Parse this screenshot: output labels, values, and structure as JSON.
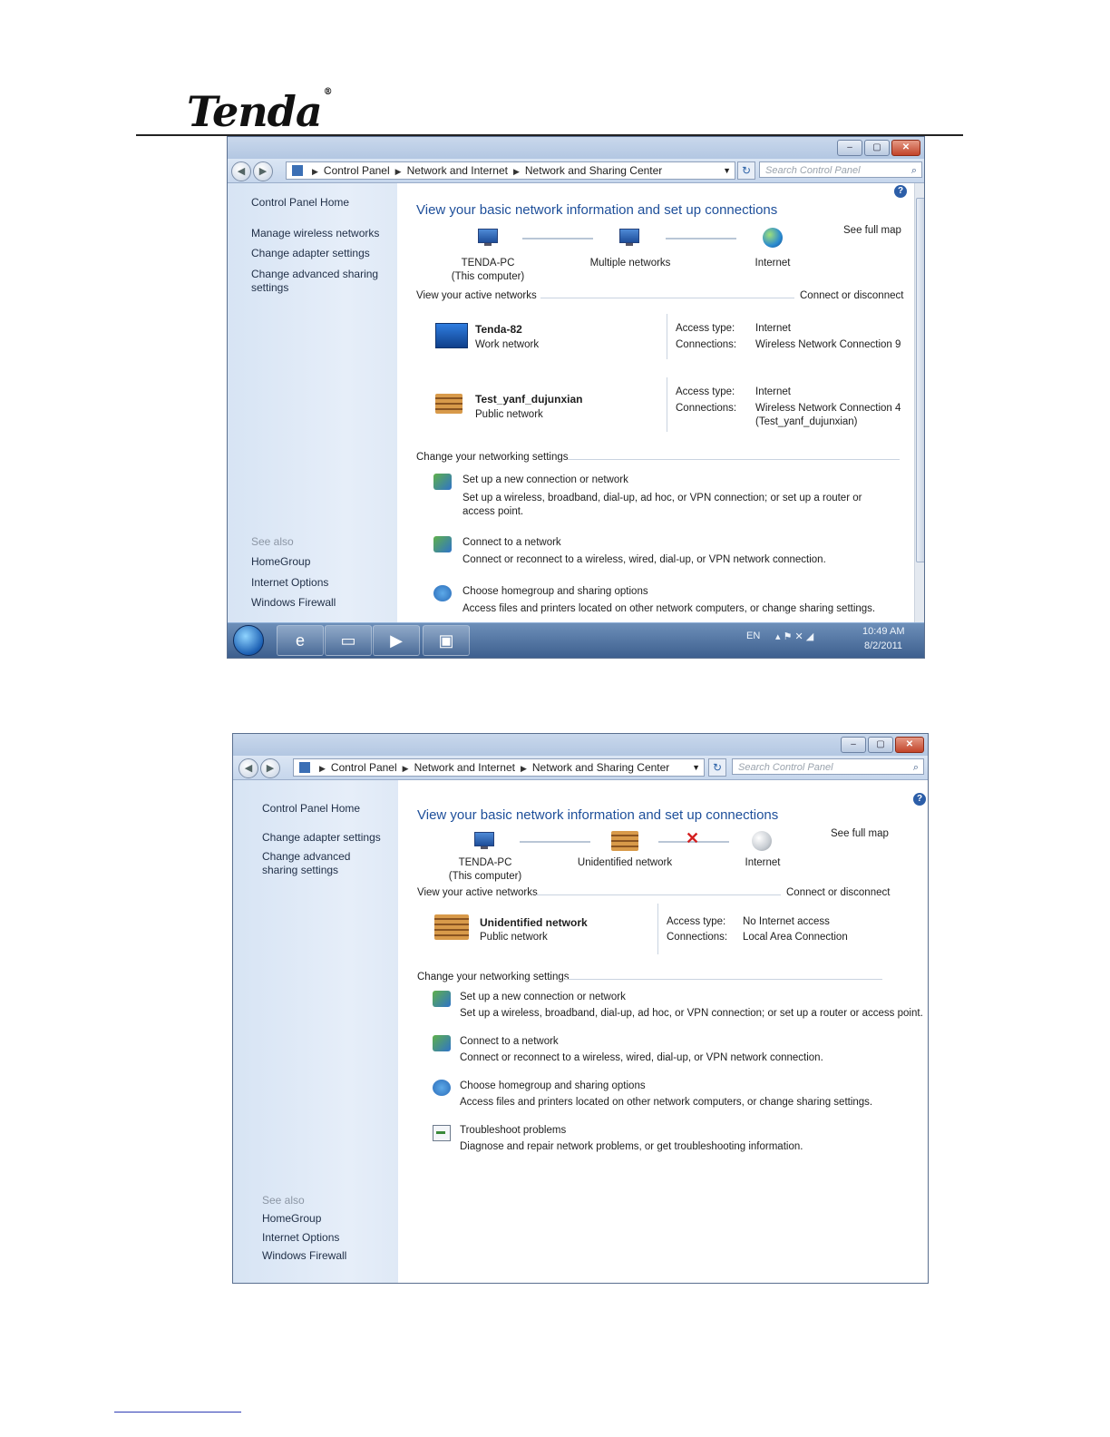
{
  "logo": {
    "text": "Tenda",
    "mark": "®"
  },
  "window1": {
    "title_buttons": {
      "minimize": "–",
      "restore": "▢",
      "close": "✕"
    },
    "address": {
      "crumbs": [
        "Control Panel",
        "Network and Internet",
        "Network and Sharing Center"
      ]
    },
    "search_placeholder": "Search Control Panel",
    "left": {
      "home": "Control Panel Home",
      "links": [
        "Manage wireless networks",
        "Change adapter settings",
        "Change advanced sharing settings"
      ],
      "see_also": "See also",
      "see_also_links": [
        "HomeGroup",
        "Internet Options",
        "Windows Firewall"
      ]
    },
    "heading": "View your basic network information and set up connections",
    "see_full_map": "See full map",
    "map": {
      "computer": "TENDA-PC",
      "computer_sub": "(This computer)",
      "middle": "Multiple networks",
      "internet": "Internet"
    },
    "active_title": "View your active networks",
    "connect_disconnect": "Connect or disconnect",
    "networks": [
      {
        "name": "Tenda-82",
        "type": "Work network",
        "access_label": "Access type:",
        "access_value": "Internet",
        "connections_label": "Connections:",
        "connection": "Wireless Network Connection 9",
        "connection_sub": ""
      },
      {
        "name": "Test_yanf_dujunxian",
        "type": "Public network",
        "access_label": "Access type:",
        "access_value": "Internet",
        "connections_label": "Connections:",
        "connection": "Wireless Network Connection 4",
        "connection_sub": "(Test_yanf_dujunxian)"
      }
    ],
    "change_title": "Change your networking settings",
    "tasks": [
      {
        "link": "Set up a new connection or network",
        "desc": "Set up a wireless, broadband, dial-up, ad hoc, or VPN connection; or set up a router or access point."
      },
      {
        "link": "Connect to a network",
        "desc": "Connect or reconnect to a wireless, wired, dial-up, or VPN network connection."
      },
      {
        "link": "Choose homegroup and sharing options",
        "desc": "Access files and printers located on other network computers, or change sharing settings."
      }
    ],
    "taskbar": {
      "lang": "EN",
      "time": "10:49 AM",
      "date": "8/2/2011"
    }
  },
  "window2": {
    "title_buttons": {
      "minimize": "–",
      "restore": "▢",
      "close": "✕"
    },
    "address": {
      "crumbs": [
        "Control Panel",
        "Network and Internet",
        "Network and Sharing Center"
      ]
    },
    "search_placeholder": "Search Control Panel",
    "left": {
      "home": "Control Panel Home",
      "links": [
        "Change adapter settings",
        "Change advanced sharing settings"
      ],
      "see_also": "See also",
      "see_also_links": [
        "HomeGroup",
        "Internet Options",
        "Windows Firewall"
      ]
    },
    "heading": "View your basic network information and set up connections",
    "see_full_map": "See full map",
    "map": {
      "computer": "TENDA-PC",
      "computer_sub": "(This computer)",
      "middle": "Unidentified network",
      "internet": "Internet"
    },
    "active_title": "View your active networks",
    "connect_disconnect": "Connect or disconnect",
    "network": {
      "name": "Unidentified network",
      "type": "Public network",
      "access_label": "Access type:",
      "access_value": "No Internet access",
      "connections_label": "Connections:",
      "connection": "Local Area Connection"
    },
    "change_title": "Change your networking settings",
    "tasks": [
      {
        "link": "Set up a new connection or network",
        "desc": "Set up a wireless, broadband, dial-up, ad hoc, or VPN connection; or set up a router or access point."
      },
      {
        "link": "Connect to a network",
        "desc": "Connect or reconnect to a wireless, wired, dial-up, or VPN network connection."
      },
      {
        "link": "Choose homegroup and sharing options",
        "desc": "Access files and printers located on other network computers, or change sharing settings."
      },
      {
        "link": "Troubleshoot problems",
        "desc": "Diagnose and repair network problems, or get troubleshooting information."
      }
    ]
  }
}
